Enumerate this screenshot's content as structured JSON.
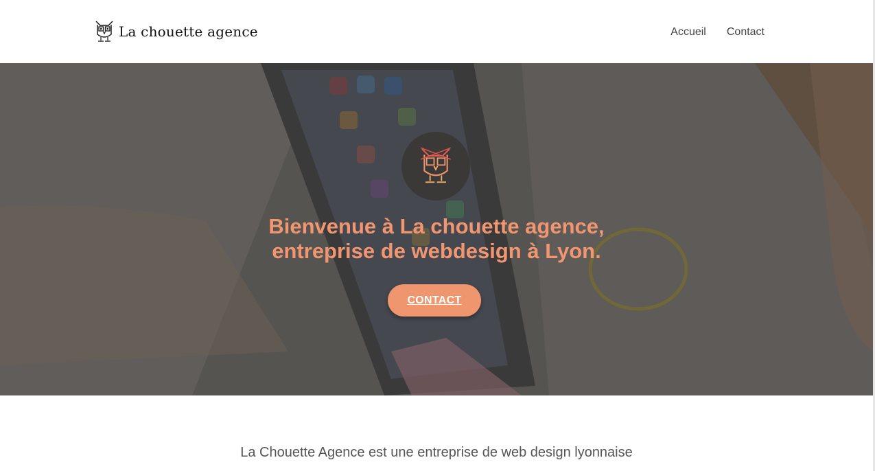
{
  "header": {
    "brand": "La chouette agence",
    "nav": [
      {
        "label": "Accueil"
      },
      {
        "label": "Contact"
      }
    ]
  },
  "hero": {
    "title_line1": "Bienvenue à La chouette agence,",
    "title_line2": "entreprise de webdesign à Lyon.",
    "cta_label": "CONTACT",
    "accent_color": "#f0966e"
  },
  "intro": {
    "text": "La Chouette Agence est une entreprise de web design lyonnaise"
  }
}
